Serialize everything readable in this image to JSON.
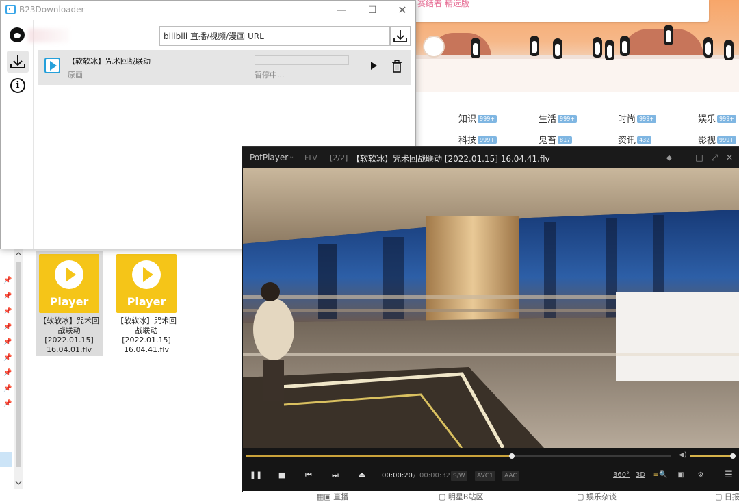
{
  "bili": {
    "top_text": "赛结者 精选版",
    "nav": [
      {
        "label": "知识",
        "badge": "999+"
      },
      {
        "label": "生活",
        "badge": "999+"
      },
      {
        "label": "时尚",
        "badge": "999+"
      },
      {
        "label": "娱乐",
        "badge": "999+"
      },
      {
        "label": "科技",
        "badge": "999+"
      },
      {
        "label": "鬼畜",
        "badge": "817"
      },
      {
        "label": "资讯",
        "badge": "432"
      },
      {
        "label": "影视",
        "badge": "999+"
      }
    ]
  },
  "b23": {
    "title": "B23Downloader",
    "url_placeholder": "bilibili 直播/视频/漫画 URL",
    "task": {
      "title": "【软软冰】咒术回战联动",
      "subtitle": "原画",
      "status": "暂停中...",
      "progress": 0
    }
  },
  "explorer": {
    "files": [
      {
        "icon_label": "Player",
        "name": "【软软冰】咒术回战联动[2022.01.15]16.04.01.flv",
        "selected": true
      },
      {
        "icon_label": "Player",
        "name": "【软软冰】咒术回战联动[2022.01.15]16.04.41.flv",
        "selected": false
      }
    ]
  },
  "pot": {
    "app_name": "PotPlayer",
    "format": "FLV",
    "index": "[2/2]",
    "title": "【软软冰】咒术回战联动 [2022.01.15] 16.04.41.flv",
    "time_current": "00:00:20",
    "time_separator": "/",
    "time_total": "00:00:32",
    "tags": [
      "S/W",
      "AVC1",
      "AAC"
    ],
    "right_buttons": [
      "360°",
      "3D"
    ],
    "seek_fraction": 0.625,
    "volume_fraction": 1.0
  },
  "bottom": [
    "直播",
    "明星B站区",
    "娱乐杂谈",
    "日报"
  ],
  "colors": {
    "pot_accent": "#c9a23b",
    "b23_accent": "#26a0da",
    "player_icon": "#f5c518"
  }
}
